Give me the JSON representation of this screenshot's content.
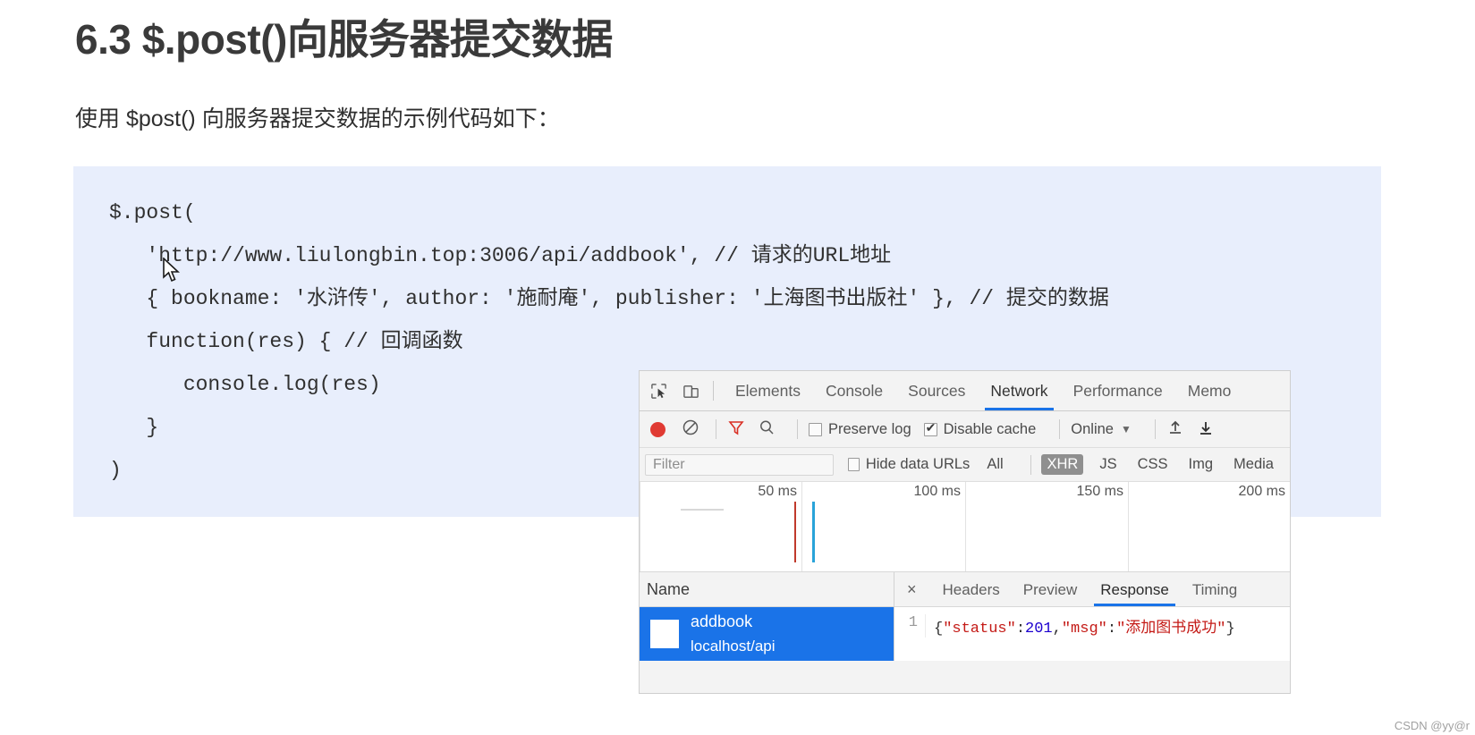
{
  "slide": {
    "title": "6.3 $.post()向服务器提交数据",
    "subtitle": "使用 $post() 向服务器提交数据的示例代码如下：",
    "code_lines": [
      "$.post(",
      "   'http://www.liulongbin.top:3006/api/addbook', // 请求的URL地址",
      "   { bookname: '水浒传', author: '施耐庵', publisher: '上海图书出版社' }, // 提交的数据",
      "   function(res) { // 回调函数",
      "      console.log(res)",
      "   }",
      ")"
    ],
    "code_bg_color": "#e8eefc"
  },
  "devtools": {
    "tabs": [
      {
        "label": "Elements",
        "active": false
      },
      {
        "label": "Console",
        "active": false
      },
      {
        "label": "Sources",
        "active": false
      },
      {
        "label": "Network",
        "active": true
      },
      {
        "label": "Performance",
        "active": false
      },
      {
        "label": "Memo",
        "active": false
      }
    ],
    "accent_color": "#1a73e8",
    "record_color": "#e03a33",
    "toolbar": {
      "preserve_log_label": "Preserve log",
      "preserve_log_checked": false,
      "disable_cache_label": "Disable cache",
      "disable_cache_checked": true,
      "throttling_value": "Online"
    },
    "filter": {
      "placeholder": "Filter",
      "value": "",
      "hide_data_urls_label": "Hide data URLs",
      "hide_data_urls_checked": false,
      "types": [
        {
          "label": "All",
          "selected": false
        },
        {
          "label": "XHR",
          "selected": true
        },
        {
          "label": "JS",
          "selected": false
        },
        {
          "label": "CSS",
          "selected": false
        },
        {
          "label": "Img",
          "selected": false
        },
        {
          "label": "Media",
          "selected": false
        }
      ]
    },
    "timeline": {
      "ticks": [
        "50 ms",
        "100 ms",
        "150 ms",
        "200 ms"
      ]
    },
    "requests": {
      "column_header": "Name",
      "rows": [
        {
          "name": "addbook",
          "path": "localhost/api",
          "selected": true
        }
      ]
    },
    "detail": {
      "close_label": "×",
      "tabs": [
        {
          "label": "Headers",
          "active": false
        },
        {
          "label": "Preview",
          "active": false
        },
        {
          "label": "Response",
          "active": true
        },
        {
          "label": "Timing",
          "active": false
        }
      ],
      "response": {
        "line_number": "1",
        "status_key": "\"status\"",
        "status_value": "201",
        "msg_key": "\"msg\"",
        "msg_value": "\"添加图书成功\""
      }
    }
  },
  "watermark": "CSDN @yy@r"
}
